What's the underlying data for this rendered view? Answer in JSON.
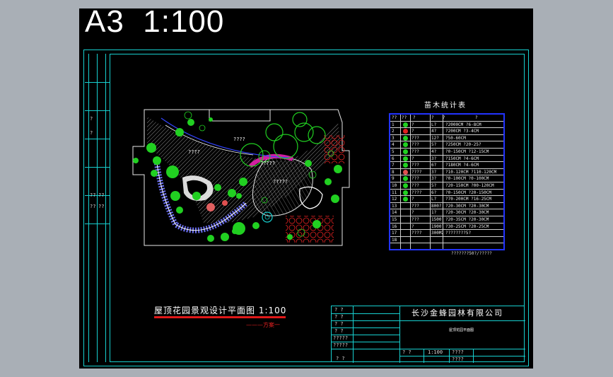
{
  "title": "A3  1:100",
  "plan_title": "屋顶花园景观设计平面图 1:100",
  "plan_subtitle": "———方案一",
  "table_title": "苗木统计表",
  "table_header": [
    "??",
    "??",
    "?",
    "?",
    "?",
    "?"
  ],
  "table_rows": [
    {
      "no": "1",
      "icon": "#21d021",
      "qty": "?",
      "spec": "L?",
      "size": "?2000CM ?6-8CM"
    },
    {
      "no": "2",
      "icon": "#e02020",
      "qty": "?",
      "spec": "4?",
      "size": "?200CM ?3-4CM"
    },
    {
      "no": "3",
      "icon": "#21d021",
      "qty": "???",
      "spec": "12?",
      "size": "?50-60CM"
    },
    {
      "no": "4",
      "icon": "#21d021",
      "qty": "???",
      "spec": "5?",
      "size": "?250CM ?20-25?"
    },
    {
      "no": "5",
      "icon": "#21d021",
      "qty": "???",
      "spec": "4?",
      "size": "?0-150CM ?12-15CM"
    },
    {
      "no": "6",
      "icon": "#21d021",
      "qty": "?",
      "spec": "3?",
      "size": "?150CM ?4-6CM"
    },
    {
      "no": "7",
      "icon": "#21d021",
      "qty": "???",
      "spec": "6?",
      "size": "?180CM ?4-6CM"
    },
    {
      "no": "8",
      "icon": "#e05050",
      "qty": "????",
      "spec": "3?",
      "size": "?10-120CM ?110-120CM"
    },
    {
      "no": "9",
      "icon": "#21d021",
      "qty": "???",
      "spec": "3?",
      "size": "?0-100CM ?0-100CM"
    },
    {
      "no": "10",
      "icon": "#21d021",
      "qty": "???",
      "spec": "5?",
      "size": "?20-150CM ?00-120CM"
    },
    {
      "no": "11",
      "icon": "#21d021",
      "qty": "????",
      "spec": "6?",
      "size": "?0-150CM ?20-150CM"
    },
    {
      "no": "12",
      "icon": "#21d021",
      "qty": "?",
      "spec": "L?",
      "size": "?70-200CM ?16-25CM"
    },
    {
      "no": "13",
      "icon": "",
      "qty": "???",
      "spec": "800?",
      "size": "?20-30CM ?20-30CM"
    },
    {
      "no": "14",
      "icon": "",
      "qty": "?",
      "spec": "1?",
      "size": "?20-30CM ?20-30CM"
    },
    {
      "no": "15",
      "icon": "",
      "qty": "???",
      "spec": "1500?",
      "size": "?20-35CM ?20-30CM"
    },
    {
      "no": "16",
      "icon": "",
      "qty": "?",
      "spec": "1900?",
      "size": "?30-25CM ?20-25CM"
    },
    {
      "no": "17",
      "icon": "",
      "qty": "????",
      "spec": "300M2",
      "size": "????????5?"
    },
    {
      "no": "18",
      "icon": "",
      "qty": "",
      "spec": "",
      "size": ""
    }
  ],
  "table_footer": "???????50?/?????",
  "company": "长沙金蜂园林有限公司",
  "drawing_name": "屋顶花园平面图",
  "scale": "1:100",
  "plan_labels": {
    "label_a": "????",
    "label_b": "????",
    "label_c": "?????",
    "label_d": "?????"
  },
  "left_marks": [
    "?",
    "?",
    "??",
    "??",
    "??",
    "??"
  ],
  "titleblock_left": [
    "? ?",
    "? ?",
    "? ?",
    "? ?",
    "?????",
    "?????",
    "? ?"
  ],
  "titleblock_bottom": [
    "? ?",
    "1:100",
    "????",
    "????"
  ],
  "colors": {
    "frame": "#17d0d0",
    "tree_green": "#21d021",
    "flower_red": "#e02020",
    "path_blue": "#3344ff",
    "pink": "#d21fa0"
  }
}
